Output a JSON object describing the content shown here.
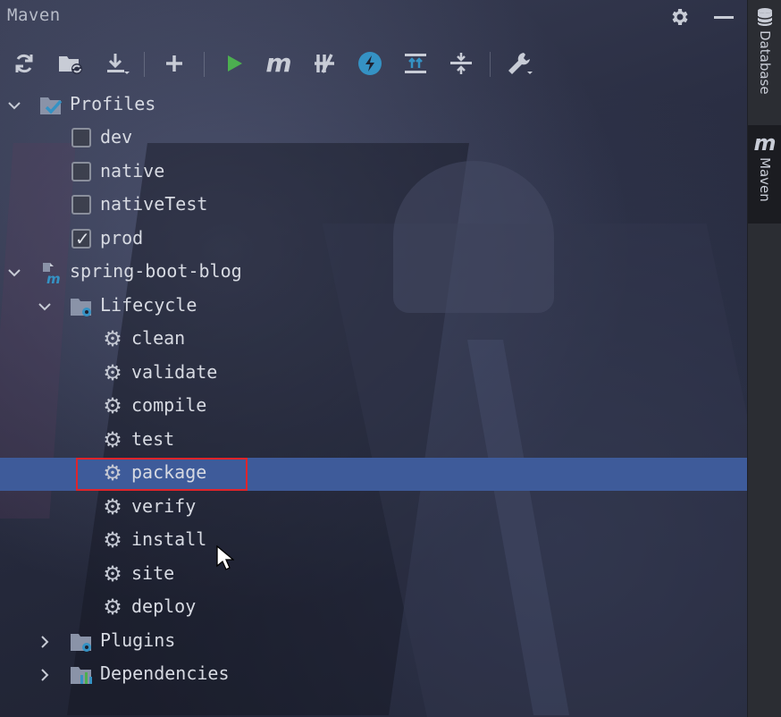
{
  "panel": {
    "title": "Maven"
  },
  "toolbar": {
    "buttons": [
      {
        "name": "reload-all-icon"
      },
      {
        "name": "reimport-folder-icon"
      },
      {
        "name": "download-sources-icon"
      },
      {
        "name": "add-project-icon"
      },
      {
        "name": "run-icon"
      },
      {
        "name": "execute-goal-icon"
      },
      {
        "name": "toggle-offline-icon"
      },
      {
        "name": "skip-tests-icon"
      },
      {
        "name": "expand-all-icon"
      },
      {
        "name": "collapse-all-icon"
      },
      {
        "name": "settings-wrench-icon"
      }
    ]
  },
  "tree": {
    "profiles": {
      "label": "Profiles",
      "items": [
        {
          "label": "dev",
          "checked": false
        },
        {
          "label": "native",
          "checked": false
        },
        {
          "label": "nativeTest",
          "checked": false
        },
        {
          "label": "prod",
          "checked": true
        }
      ]
    },
    "project": {
      "label": "spring-boot-blog"
    },
    "lifecycle": {
      "label": "Lifecycle",
      "goals": [
        "clean",
        "validate",
        "compile",
        "test",
        "package",
        "verify",
        "install",
        "site",
        "deploy"
      ],
      "selected": "package"
    },
    "plugins": {
      "label": "Plugins"
    },
    "dependencies": {
      "label": "Dependencies"
    }
  },
  "sidebar": {
    "tabs": [
      {
        "label": "Database",
        "active": false
      },
      {
        "label": "Maven",
        "active": true
      }
    ]
  },
  "colors": {
    "selection": "#3e5b9a",
    "highlight_border": "#e0242a",
    "run_green": "#4caf50",
    "accent_blue": "#3592c4"
  }
}
